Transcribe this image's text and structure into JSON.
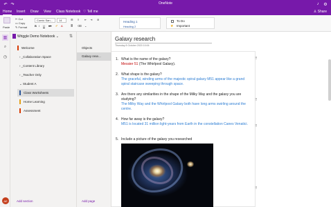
{
  "titlebar": {
    "title": "OneNote",
    "back_icon": "undo-icon",
    "fwd_icon": "redo-icon",
    "bell_icon": "bell-icon",
    "settings_icon": "gear-icon"
  },
  "menu": {
    "tabs": [
      "Home",
      "Insert",
      "Draw",
      "View",
      "Class Notebook"
    ],
    "tell_me": "Tell me",
    "share": "Share"
  },
  "ribbon": {
    "paste": "Paste",
    "cut": "Cut",
    "copy": "Copy",
    "format": "Format",
    "font_family": "Comic San...",
    "font_size": "14",
    "styles": [
      "Heading 1",
      "Heading 2"
    ],
    "tags": [
      "To Do",
      "Important"
    ]
  },
  "notebook": {
    "name": "Wriggle Demo Notebook",
    "sections": [
      {
        "label": "Welcome",
        "color": "#d83b01",
        "group": false
      },
      {
        "label": "_Collaboration Space",
        "color": "",
        "group": true
      },
      {
        "label": "_Content Library",
        "color": "",
        "group": true
      },
      {
        "label": "_Teacher Only",
        "color": "",
        "group": true
      },
      {
        "label": "Student A",
        "color": "",
        "group": true
      },
      {
        "label": "Class Worksheets",
        "color": "#2b579a",
        "group": false
      },
      {
        "label": "Home Learning",
        "color": "#e3a21a",
        "group": false
      },
      {
        "label": "Assessment",
        "color": "#d83b01",
        "group": false
      }
    ],
    "add_section": "Add section"
  },
  "pages": {
    "items": [
      "Objects",
      "Galaxy rese..."
    ],
    "add_page": "Add page"
  },
  "avatar_initials": "AE",
  "page": {
    "title": "Galaxy research",
    "date": "Thursday 8 October 2020   10:06",
    "questions": [
      {
        "num": "1.",
        "text": "What is the name of the galaxy?",
        "answer_red": "Messier 51",
        "answer_dark": " (The Whirlpool Galaxy)."
      },
      {
        "num": "2.",
        "text": "What shape is the galaxy?",
        "answer": "The graceful, winding arms of the majestic spiral galaxy M51 appear like a grand spiral staircase sweeping through space."
      },
      {
        "num": "3.",
        "text": "Are there any similarities in the shape of the Milky Way and the galaxy you are studying?",
        "answer": "The Milky Way and the Whirlpool Galaxy both have long arms swirling around the centre."
      },
      {
        "num": "4.",
        "text": "How far away is the galaxy?",
        "answer": "M51 is located 31 million light-years from Earth in the constellation Canes Venatici."
      },
      {
        "num": "5.",
        "text": "Include a picture of the galaxy you researched"
      }
    ]
  },
  "colors": {
    "accent": "#7719aa",
    "link": "#2b7cd3",
    "red": "#c00000"
  }
}
